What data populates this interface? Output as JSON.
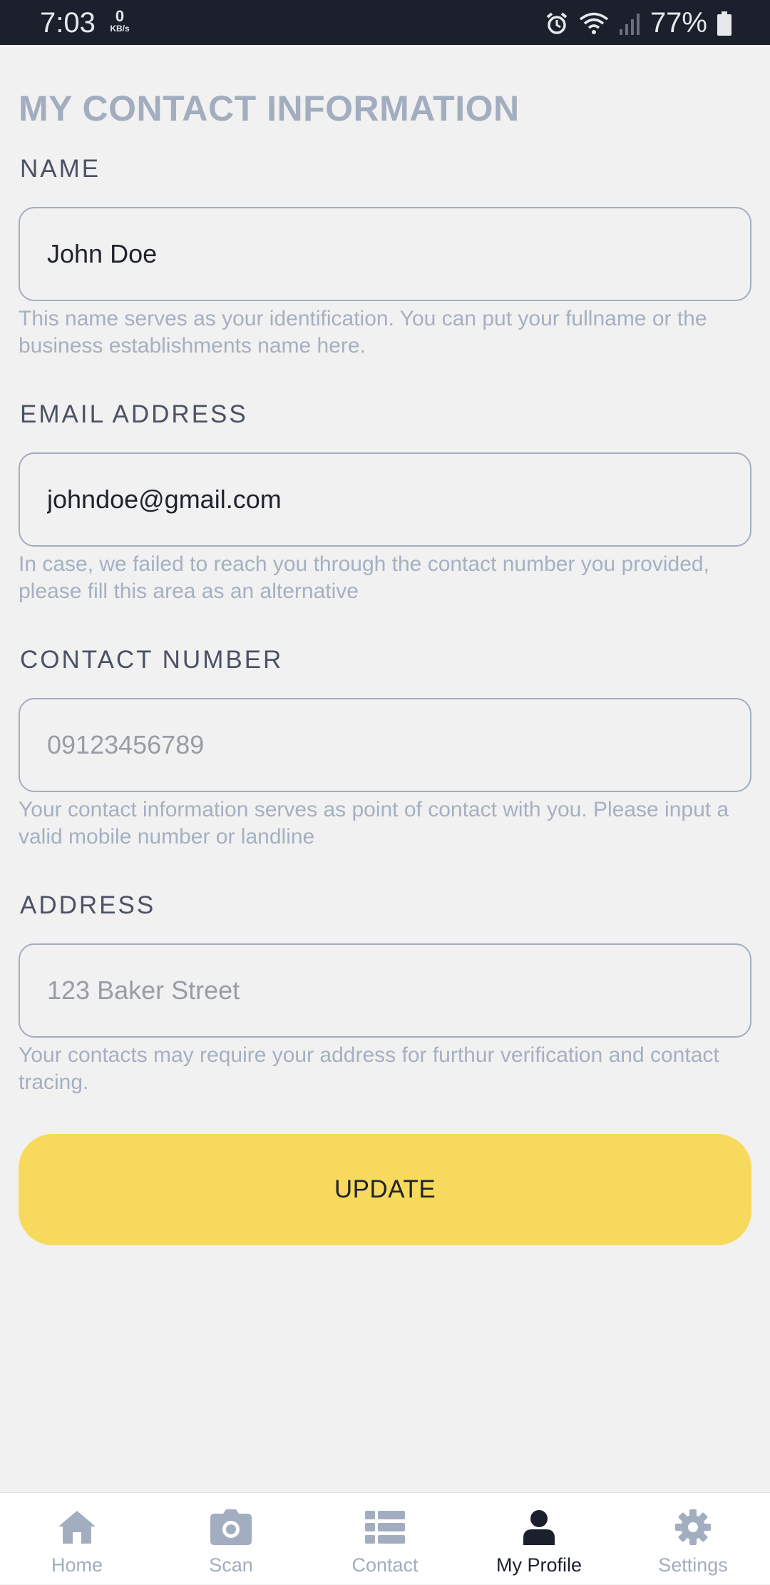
{
  "status_bar": {
    "time": "7:03",
    "net_speed_value": "0",
    "net_speed_unit": "KB/s",
    "battery": "77%",
    "icons": [
      "alarm-icon",
      "wifi-icon",
      "signal-icon",
      "battery-icon"
    ]
  },
  "page": {
    "title": "MY CONTACT INFORMATION"
  },
  "fields": {
    "name": {
      "label": "NAME",
      "value": "John Doe",
      "help": "This name serves as your identification. You can put your fullname or the business establishments name here."
    },
    "email": {
      "label": "EMAIL ADDRESS",
      "value": "johndoe@gmail.com",
      "help": "In case, we failed to reach you through the contact number you provided, please fill this area as an alternative"
    },
    "contact": {
      "label": "CONTACT NUMBER",
      "placeholder": "09123456789",
      "help": "Your contact information serves as point of contact with you. Please input a valid mobile number or landline"
    },
    "address": {
      "label": "ADDRESS",
      "placeholder": "123 Baker Street",
      "help": "Your contacts may require your address for furthur verification and contact tracing."
    }
  },
  "update_button": {
    "label": "UPDATE"
  },
  "bottom_nav": {
    "items": [
      {
        "label": "Home",
        "icon": "home-icon",
        "active": false
      },
      {
        "label": "Scan",
        "icon": "camera-icon",
        "active": false
      },
      {
        "label": "Contact",
        "icon": "list-icon",
        "active": false
      },
      {
        "label": "My Profile",
        "icon": "user-icon",
        "active": true
      },
      {
        "label": "Settings",
        "icon": "gear-icon",
        "active": false
      }
    ]
  },
  "colors": {
    "accent": "#f7da5d",
    "status_bar": "#1b202c",
    "muted": "#a2adbf"
  }
}
